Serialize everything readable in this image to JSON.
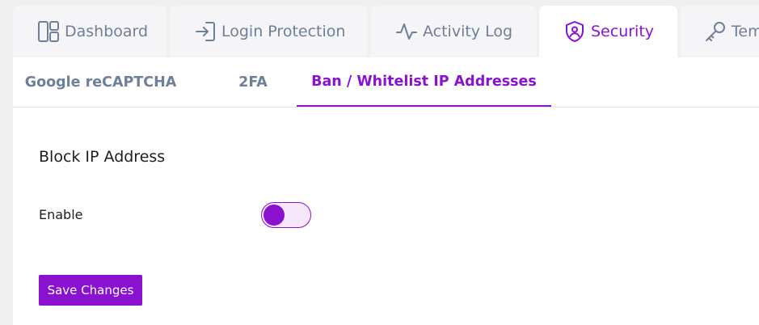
{
  "top_tabs": [
    {
      "label": "Dashboard",
      "icon": "dashboard-icon"
    },
    {
      "label": "Login Protection",
      "icon": "login-icon"
    },
    {
      "label": "Activity Log",
      "icon": "activity-icon"
    },
    {
      "label": "Security",
      "icon": "shield-user-icon",
      "active": true
    },
    {
      "label": "Tem",
      "icon": "key-icon"
    }
  ],
  "sub_tabs": [
    {
      "label": "Google reCAPTCHA"
    },
    {
      "label": "2FA"
    },
    {
      "label": "Ban / Whitelist IP Addresses",
      "active": true
    }
  ],
  "section": {
    "title": "Block IP Address",
    "enable_label": "Enable",
    "enable_toggle": "on"
  },
  "save_button_label": "Save Changes",
  "colors": {
    "accent": "#8a12cf",
    "muted_text": "#6e7f99",
    "background": "#f0f0f1",
    "panel": "#ffffff"
  }
}
